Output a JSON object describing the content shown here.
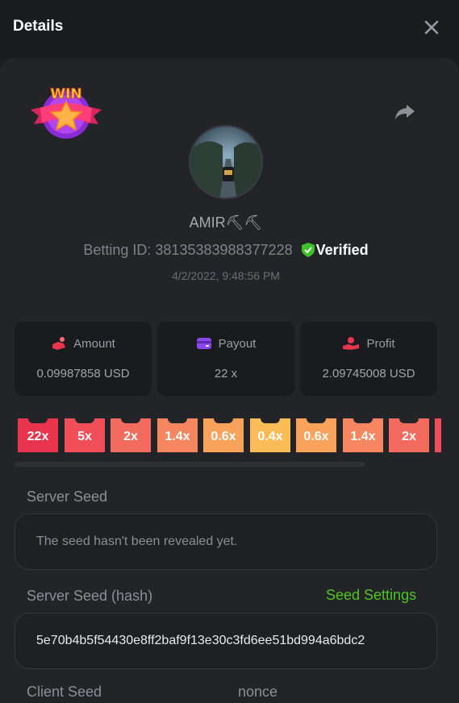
{
  "header": {
    "title": "Details",
    "close_icon": "close-icon"
  },
  "player": {
    "username": "AMIR⛏⛏",
    "betting_id_label": "Betting ID:",
    "betting_id": "38135383988377228",
    "verified_label": "Verified",
    "date": "4/2/2022, 9:48:56 PM",
    "badge_text": "WIN"
  },
  "stats": [
    {
      "label": "Amount",
      "value": "0.09987858 USD",
      "icon": "coin-hand-icon"
    },
    {
      "label": "Payout",
      "value": "22 x",
      "icon": "wallet-icon"
    },
    {
      "label": "Profit",
      "value": "2.09745008 USD",
      "icon": "profit-hand-icon"
    }
  ],
  "multipliers": [
    {
      "label": "22x",
      "color": "#e8344d"
    },
    {
      "label": "5x",
      "color": "#f04f59"
    },
    {
      "label": "2x",
      "color": "#f36a5e"
    },
    {
      "label": "1.4x",
      "color": "#f5865f"
    },
    {
      "label": "0.6x",
      "color": "#f8a25c"
    },
    {
      "label": "0.4x",
      "color": "#fbbc57"
    },
    {
      "label": "0.6x",
      "color": "#f8a25c"
    },
    {
      "label": "1.4x",
      "color": "#f5865f"
    },
    {
      "label": "2x",
      "color": "#f36a5e"
    }
  ],
  "seeds": {
    "server_seed_label": "Server Seed",
    "server_seed_value": "The seed hasn't been revealed yet.",
    "server_hash_label": "Server Seed (hash)",
    "seed_settings_link": "Seed Settings",
    "server_hash_value": "5e70b4b5f54430e8ff2baf9f13e30c3fd6ee51bd994a6bdc2",
    "client_seed_label": "Client Seed",
    "nonce_label": "nonce"
  },
  "colors": {
    "accent_green": "#4fc521",
    "panel": "#232428",
    "background": "#1b1c20"
  }
}
